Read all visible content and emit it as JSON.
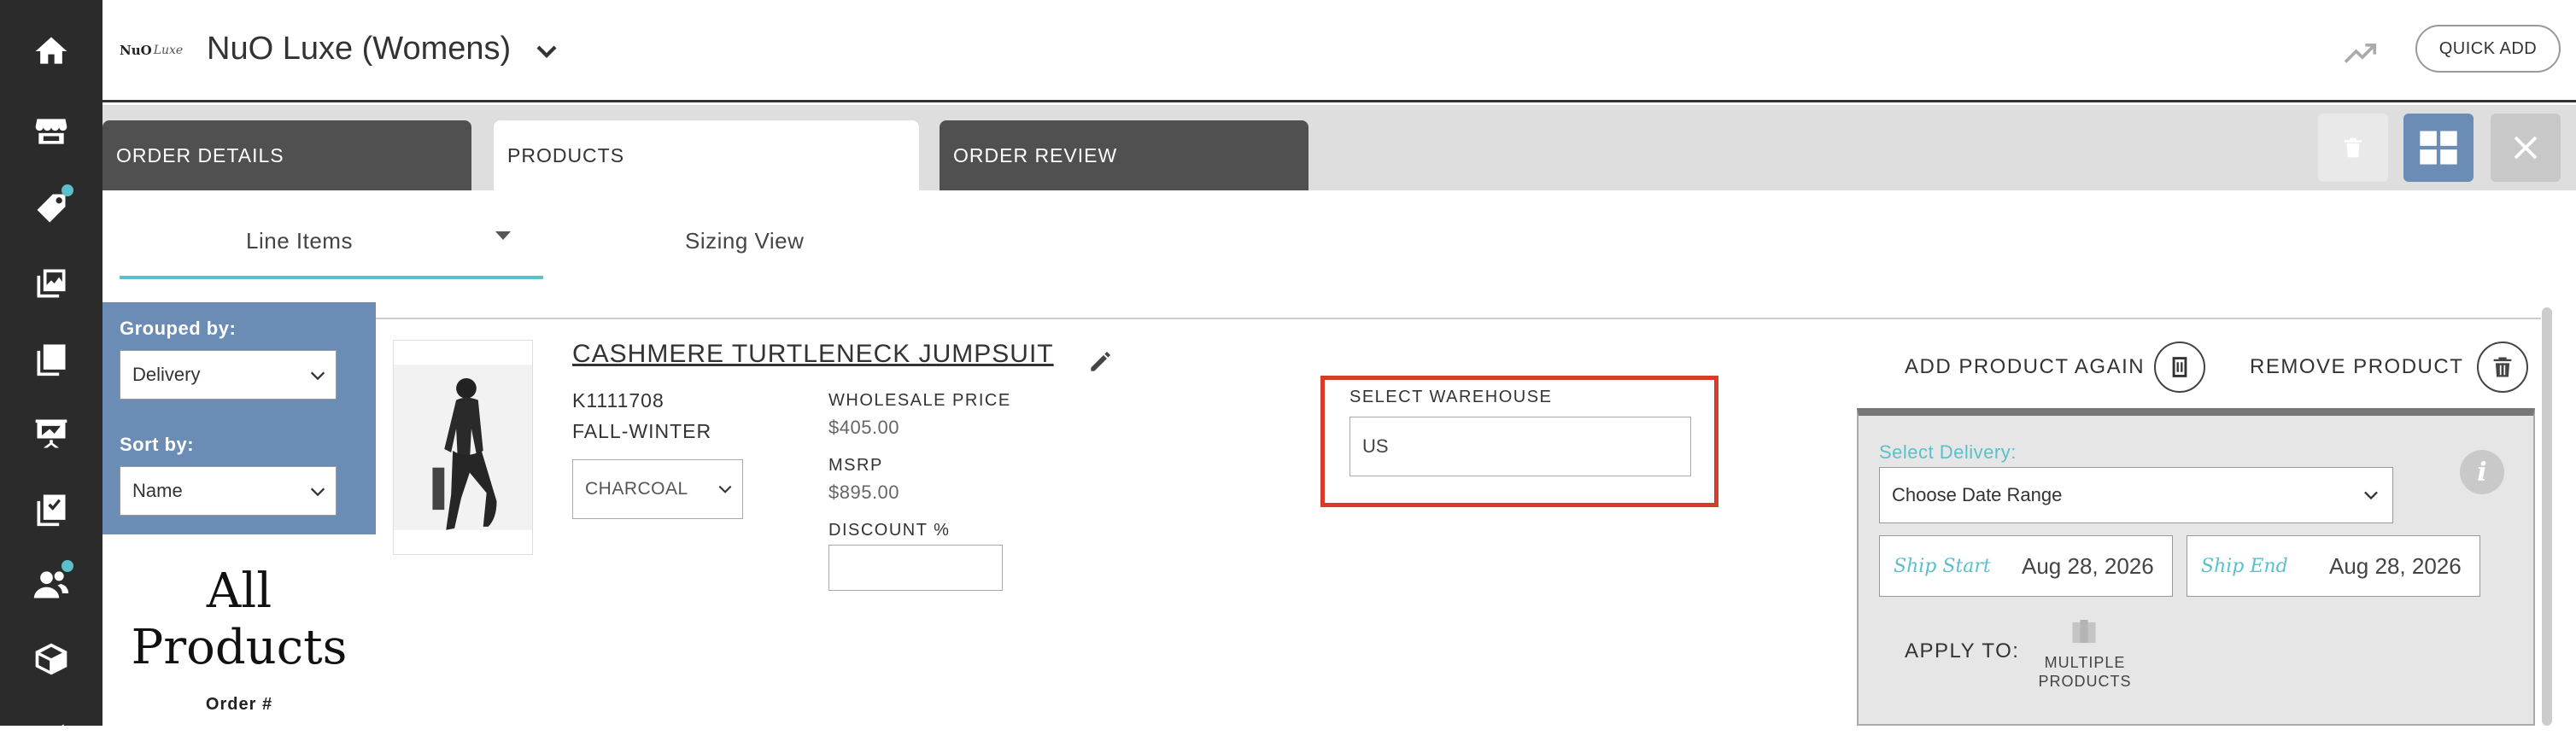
{
  "brand": {
    "logo_text": "NuO",
    "logo_script": "Luxe",
    "title": "NuO Luxe (Womens)"
  },
  "header": {
    "quick_add_label": "QUICK ADD"
  },
  "tabs": [
    {
      "label": "ORDER DETAILS"
    },
    {
      "label": "PRODUCTS"
    },
    {
      "label": "ORDER REVIEW"
    }
  ],
  "subtabs": {
    "line_items": "Line Items",
    "sizing_view": "Sizing View"
  },
  "filters": {
    "grouped_by_label": "Grouped by:",
    "grouped_by_value": "Delivery",
    "sort_by_label": "Sort by:",
    "sort_by_value": "Name"
  },
  "sidebar": {
    "all_products_line1": "All",
    "all_products_line2": "Products",
    "order_number_label": "Order #"
  },
  "product": {
    "name": "CASHMERE TURTLENECK JUMPSUIT",
    "sku": "K1111708",
    "season": "FALL-WINTER",
    "color": "CHARCOAL",
    "wholesale_label": "WHOLESALE PRICE",
    "wholesale_value": "$405.00",
    "msrp_label": "MSRP",
    "msrp_value": "$895.00",
    "discount_label": "DISCOUNT %",
    "discount_value": ""
  },
  "warehouse": {
    "label": "SELECT WAREHOUSE",
    "value": "US"
  },
  "actions": {
    "add_again": "ADD PRODUCT AGAIN",
    "remove": "REMOVE PRODUCT"
  },
  "delivery": {
    "label": "Select Delivery:",
    "date_range": "Choose Date Range",
    "ship_start_label": "Ship Start",
    "ship_start_value": "Aug 28, 2026",
    "ship_end_label": "Ship End",
    "ship_end_value": "Aug 28, 2026",
    "apply_to_label": "APPLY TO:",
    "multiple_line1": "MULTIPLE",
    "multiple_line2": "PRODUCTS"
  },
  "colors": {
    "accent_teal": "#5bc0c9",
    "filter_blue": "#6b8db5",
    "highlight_red": "#d93b2b",
    "nav_dark": "#2b2b2b"
  }
}
